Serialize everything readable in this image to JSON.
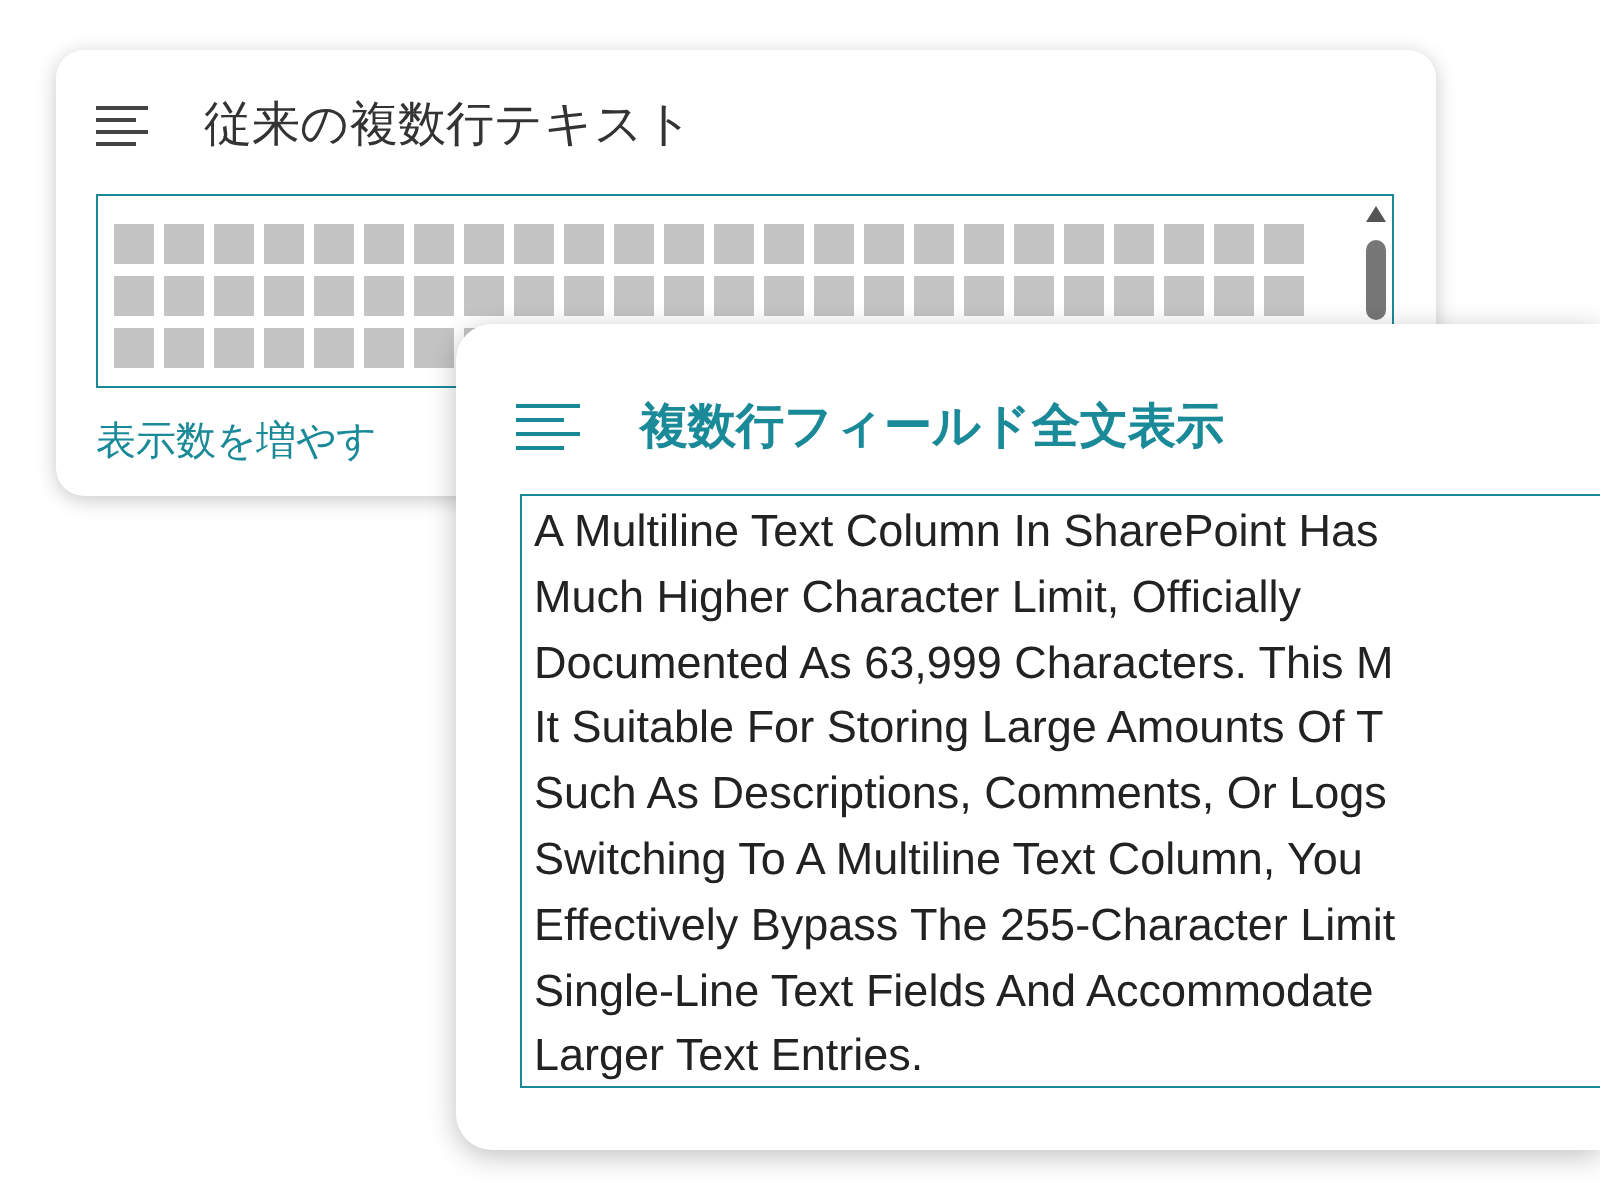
{
  "legacy_card": {
    "title": "従来の複数行テキスト",
    "link": "表示数を増やす"
  },
  "full_text_card": {
    "title": "複数行フィールド全文表示",
    "lines": [
      "A Multiline Text Column In SharePoint Has",
      "Much Higher Character Limit, Officially",
      "Documented As 63,999 Characters. This M",
      "It Suitable For Storing Large Amounts Of T",
      "Such As Descriptions, Comments, Or Logs",
      "Switching To A Multiline Text Column, You",
      "Effectively Bypass The 255-Character Limit",
      "Single-Line Text Fields And Accommodate",
      "Larger Text Entries."
    ]
  }
}
